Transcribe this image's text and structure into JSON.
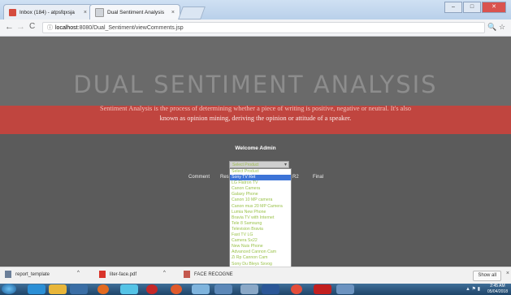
{
  "browser": {
    "tabs": [
      {
        "label": "Inbox (184) - atpsfqxsja",
        "active": false
      },
      {
        "label": "Dual Sentiment Analysis",
        "active": true
      }
    ],
    "tab_close": "×",
    "nav": {
      "back": "←",
      "forward": "→",
      "reload": "C"
    },
    "url_host": "localhost",
    "url_path": ":8080/Dual_Sentiment/viewComments.jsp",
    "info_icon": "ⓘ",
    "zoom_icon": "🔍",
    "star_icon": "☆",
    "window_buttons": {
      "min": "–",
      "max": "□",
      "close": "✕"
    }
  },
  "page": {
    "title": "DUAL SENTIMENT ANALYSIS",
    "description_line1": "Sentiment Analysis is the process of determining whether a piece of writing is positive, negative or neutral. It's also",
    "description_line2": "known as opinion mining, deriving the opinion or attitude of a speaker.",
    "welcome": "Welcome Admin",
    "columns": {
      "comment": "Comment",
      "res": "Res",
      "col3": "R2",
      "final": "Final"
    },
    "select": {
      "value": "Select Product"
    },
    "dropdown_options": [
      "Select Product",
      "Sony TV Ret",
      "LG Flatron TV",
      "Canon Camera",
      "Galaxy Phone",
      "Canon 10 MP camera",
      "Canon mus 20 MP Camera",
      "Lumia New Phone",
      "Bravia TV with Internet",
      "Tele 8 Samsung",
      "Television Bravia",
      "Fast TV LG",
      "Camera Sx22",
      "New Nuis Phone",
      "Advanced Cannon Cam",
      "Zi Rp Cannon Cam",
      "Sony Du Bleys Sxvog",
      "Adam Tv",
      "Galaxy Bag"
    ],
    "selected_index": 1
  },
  "downloads": {
    "items": [
      {
        "name": "report_template"
      },
      {
        "name": "liter-face.pdf"
      },
      {
        "name": "FACE RECOGNE"
      }
    ],
    "chevron": "^",
    "show_all": "Show all",
    "close": "×"
  },
  "taskbar": {
    "time": "2:45 AM",
    "date": "05/04/2018"
  },
  "colors": {
    "accent_red": "#c0453f",
    "page_bg": "#5b5b5b",
    "dropdown_text": "#9ac24a",
    "selection": "#3d74d7"
  }
}
